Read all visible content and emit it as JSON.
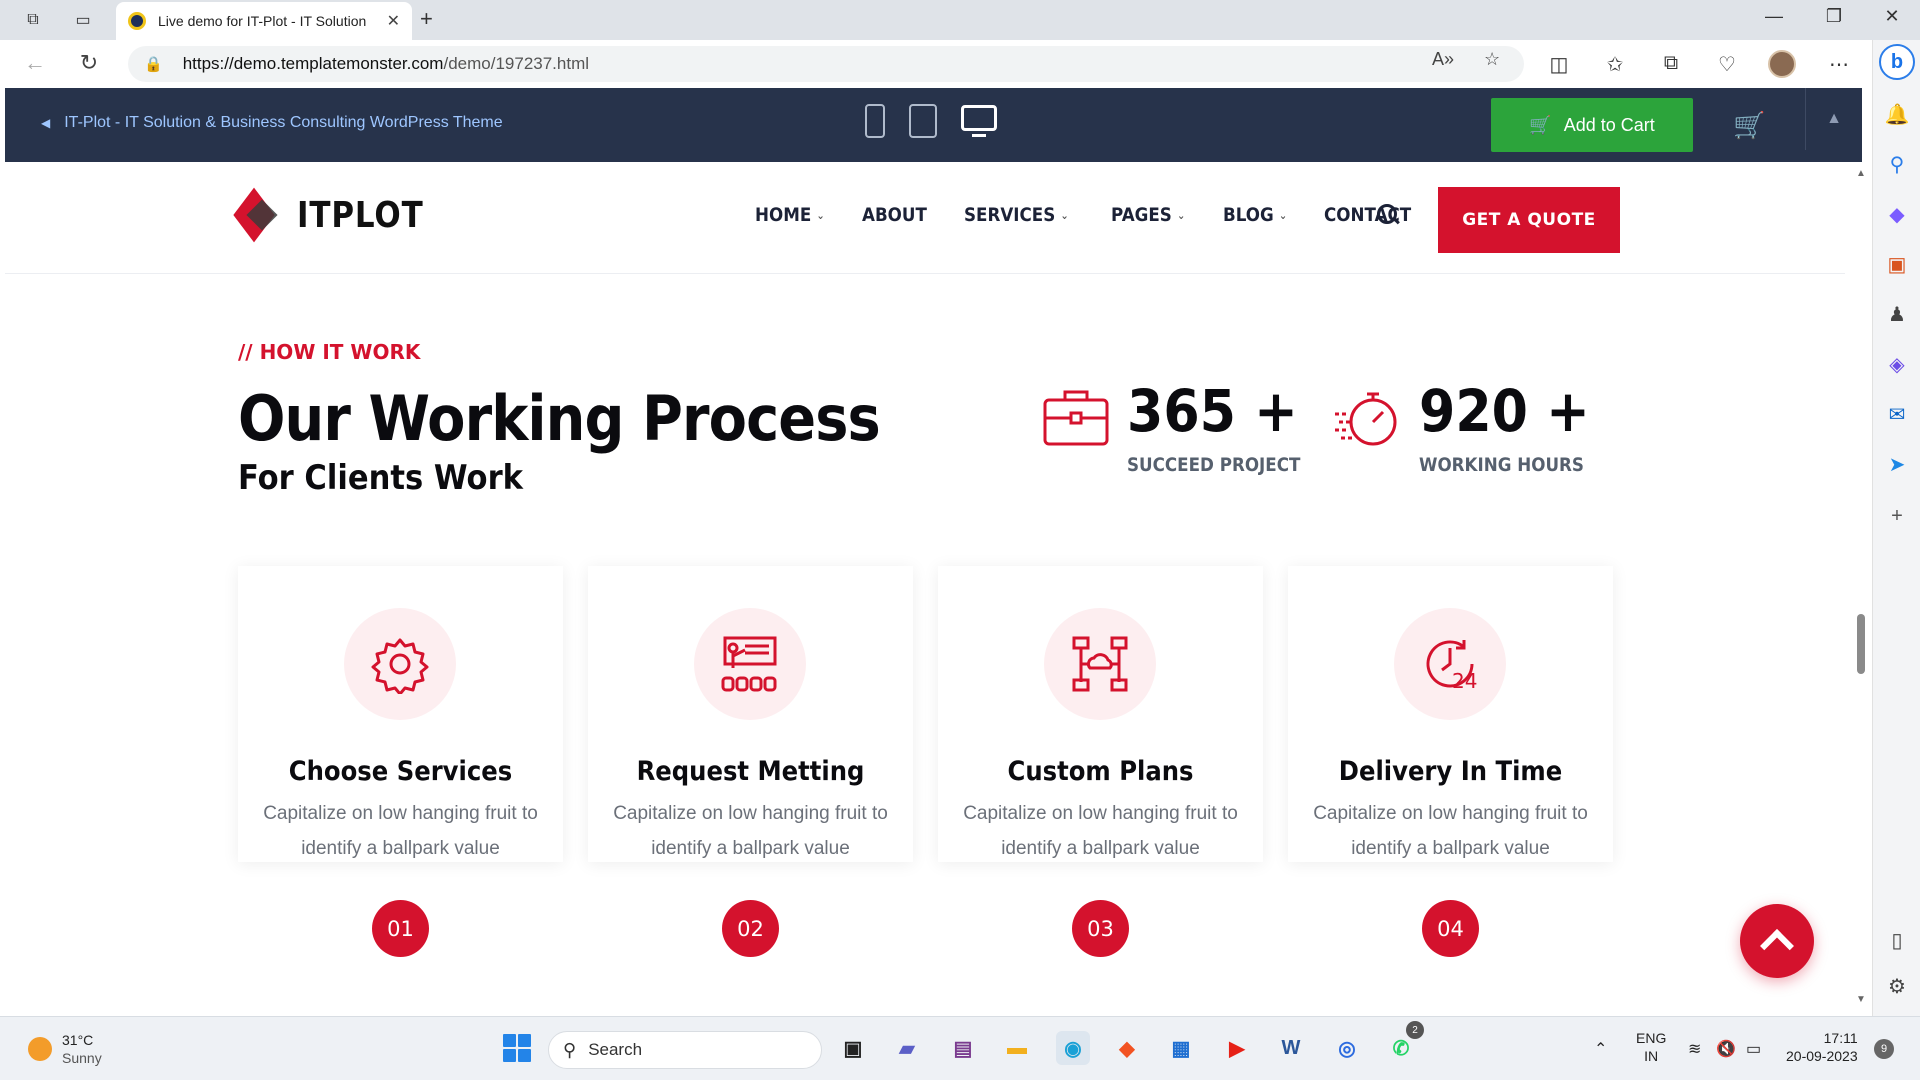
{
  "browser": {
    "tab_title": "Live demo for IT-Plot - IT Solution",
    "url_host": "https://demo.templatemonster.com",
    "url_path": "/demo/197237.html"
  },
  "tm_bar": {
    "back_label": "IT-Plot - IT Solution & Business Consulting WordPress Theme",
    "cart_label": "Add to Cart"
  },
  "site": {
    "logo_text": "ITPLOT",
    "nav": [
      "HOME",
      "ABOUT",
      "SERVICES",
      "PAGES",
      "BLOG",
      "CONTACT"
    ],
    "quote_label": "GET A QUOTE"
  },
  "section": {
    "tag": "// HOW IT WORK",
    "title": "Our Working Process",
    "subtitle": "For Clients Work",
    "stats": [
      {
        "value": "365 +",
        "label": "SUCCEED PROJECT",
        "icon": "briefcase-icon"
      },
      {
        "value": "920 +",
        "label": "WORKING HOURS",
        "icon": "stopwatch-icon"
      }
    ],
    "cards": [
      {
        "title": "Choose Services",
        "desc": "Capitalize on low hanging fruit to identify a ballpark value",
        "number": "01",
        "icon": "gear-icon"
      },
      {
        "title": "Request Metting",
        "desc": "Capitalize on low hanging fruit to identify a ballpark value",
        "number": "02",
        "icon": "presentation-icon"
      },
      {
        "title": "Custom Plans",
        "desc": "Capitalize on low hanging fruit to identify a ballpark value",
        "number": "03",
        "icon": "cloud-network-icon"
      },
      {
        "title": "Delivery In Time",
        "desc": "Capitalize on low hanging fruit to identify a ballpark value",
        "number": "04",
        "icon": "clock-24-icon"
      }
    ]
  },
  "taskbar": {
    "temperature": "31°C",
    "condition": "Sunny",
    "search_placeholder": "Search",
    "lang": "ENG",
    "region": "IN",
    "time": "17:11",
    "date": "20-09-2023",
    "notifications": "9",
    "whatsapp_badge": "2"
  },
  "colors": {
    "accent": "#d4122d",
    "tm_bar": "#27334b",
    "cart_green": "#2ca43b"
  }
}
